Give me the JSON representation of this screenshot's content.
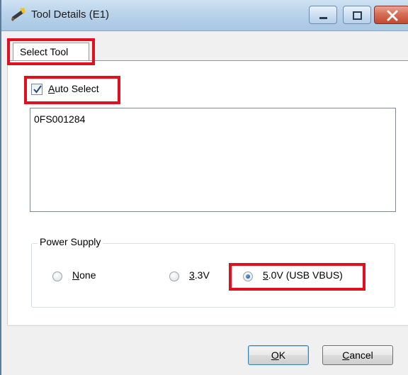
{
  "window": {
    "title": "Tool Details (E1)"
  },
  "tabs": [
    {
      "label": "Select Tool",
      "active": true
    }
  ],
  "auto_select": {
    "label_first": "A",
    "label_rest": "uto Select",
    "checked": true
  },
  "tool_list": {
    "items": [
      "0FS001284"
    ]
  },
  "power_supply": {
    "title": "Power Supply",
    "options": [
      {
        "first": "N",
        "rest": "one",
        "selected": false
      },
      {
        "first": "3",
        "rest": ".3V",
        "selected": false
      },
      {
        "first": "5",
        "rest": ".0V (USB VBUS)",
        "selected": true
      }
    ]
  },
  "buttons": {
    "ok_first": "O",
    "ok_rest": "K",
    "cancel_first": "C",
    "cancel_rest": "ancel"
  },
  "colors": {
    "highlight": "#e0101e",
    "radio_selected": "#1d5fa6"
  }
}
